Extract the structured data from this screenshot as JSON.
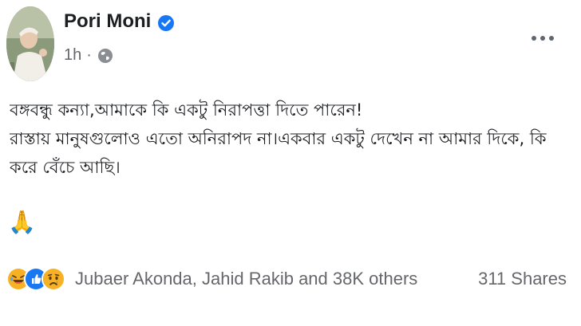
{
  "post": {
    "author": "Pori Moni",
    "verified": true,
    "time": "1h",
    "separator": "·",
    "privacy_icon": "globe-icon",
    "more_icon": "more-options-icon",
    "text_lines": [
      "বঙ্গবন্ধু কন্যা,আমাকে কি একটু নিরাপত্তা দিতে পারেন!",
      "রাস্তায় মানুষগুলোও এতো অনিরাপদ না।একবার একটু দেখেন না আমার দিকে, কি",
      "করে বেঁচে আছি।"
    ],
    "emoji": "🙏",
    "reactions": {
      "icons": [
        "laugh-reaction-icon",
        "like-reaction-icon",
        "sad-reaction-icon"
      ],
      "summary": "Jubaer Akonda, Jahid Rakib and 38K others"
    },
    "shares": "311 Shares"
  },
  "colors": {
    "brand_blue": "#1877f2",
    "text_primary": "#1c1e21",
    "text_secondary": "#65676b",
    "reaction_yellow": "#f7b125"
  }
}
